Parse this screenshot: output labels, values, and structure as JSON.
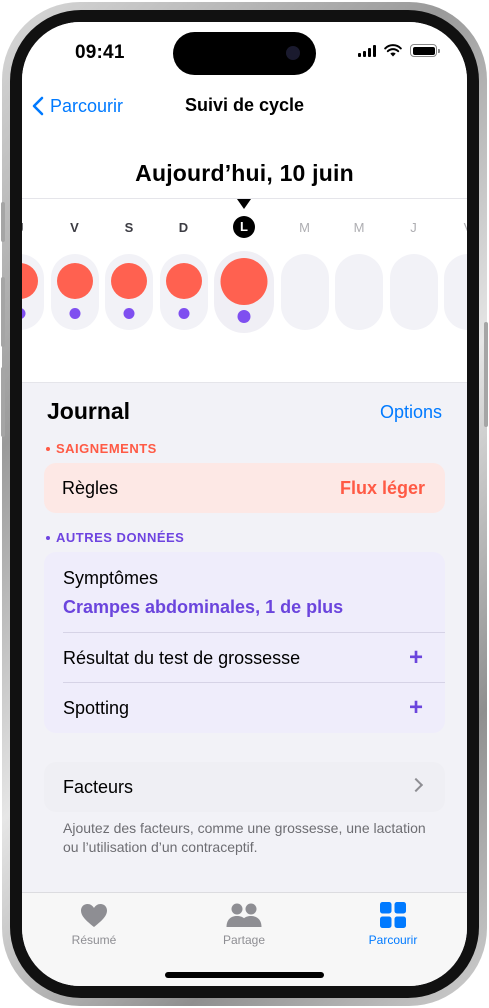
{
  "status_bar": {
    "time": "09:41"
  },
  "nav": {
    "back_label": "Parcourir",
    "title": "Suivi de cycle"
  },
  "calendar": {
    "date_heading": "Aujourd’hui, 10 juin",
    "days": [
      {
        "letter": "J",
        "flow": "small",
        "symptom": true,
        "state": "past"
      },
      {
        "letter": "V",
        "flow": "small",
        "symptom": true,
        "state": "past"
      },
      {
        "letter": "S",
        "flow": "small",
        "symptom": true,
        "state": "past"
      },
      {
        "letter": "D",
        "flow": "small",
        "symptom": true,
        "state": "past"
      },
      {
        "letter": "L",
        "flow": "big",
        "symptom": true,
        "state": "today"
      },
      {
        "letter": "M",
        "flow": "none",
        "symptom": false,
        "state": "future"
      },
      {
        "letter": "M",
        "flow": "none",
        "symptom": false,
        "state": "future"
      },
      {
        "letter": "J",
        "flow": "none",
        "symptom": false,
        "state": "future"
      },
      {
        "letter": "V",
        "flow": "none",
        "symptom": false,
        "state": "future"
      }
    ]
  },
  "journal": {
    "title": "Journal",
    "options_label": "Options",
    "bleeding": {
      "section_label": "SAIGNEMENTS",
      "row_label": "Règles",
      "row_value": "Flux léger"
    },
    "other": {
      "section_label": "AUTRES DONNÉES",
      "symptoms_title": "Symptômes",
      "symptoms_value": "Crampes abdominales, 1 de plus",
      "pregnancy_test_label": "Résultat du test de grossesse",
      "spotting_label": "Spotting"
    },
    "factors": {
      "label": "Facteurs",
      "note": "Ajoutez des facteurs, comme une grossesse, une lactation ou l’utilisation d’un contraceptif."
    }
  },
  "tab_bar": {
    "tabs": [
      {
        "label": "Résumé",
        "icon": "heart-icon",
        "active": false
      },
      {
        "label": "Partage",
        "icon": "people-icon",
        "active": false
      },
      {
        "label": "Parcourir",
        "icon": "grid-icon",
        "active": true
      }
    ]
  },
  "colors": {
    "accent": "#007aff",
    "period": "#ff6150",
    "symptom": "#7f4ff0",
    "bleeding_card": "#fde8e5",
    "other_card": "#efedfb"
  }
}
